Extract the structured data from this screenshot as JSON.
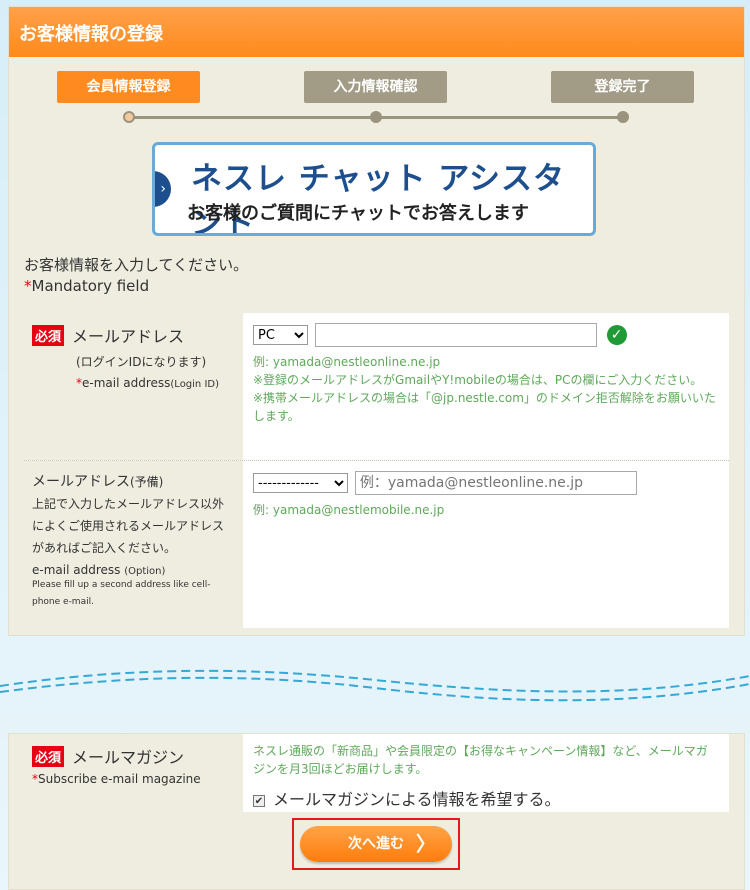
{
  "header": {
    "title": "お客様情報の登録"
  },
  "steps": [
    {
      "label": "会員情報登録"
    },
    {
      "label": "入力情報確認"
    },
    {
      "label": "登録完了"
    }
  ],
  "banner": {
    "title": "ネスレ チャット アシスタント",
    "subtitle": "お客様のご質問にチャットでお答えします",
    "arrow": "›"
  },
  "intro": "お客様情報を入力してください。",
  "mandatory": {
    "mark": "*",
    "text": "Mandatory field"
  },
  "required_badge": "必須",
  "email": {
    "label": "メールアドレス",
    "sub": "(ログインIDになります)",
    "en_mark": "*",
    "en": "e-mail address",
    "en_small": "(Login ID)",
    "device": "PC",
    "value": "",
    "example": "例: yamada@nestleonline.ne.jp",
    "note1": "※登録のメールアドレスがGmailやY!mobileの場合は、PCの欄にご入力ください。",
    "note2": "※携帯メールアドレスの場合は「@jp.nestle.com」のドメイン拒否解除をお願いいたします。"
  },
  "email2": {
    "label": "メールアドレス",
    "label_small": "(予備)",
    "desc": "上記で入力したメールアドレス以外によくご使用されるメールアドレスがあればご記入ください。",
    "en": "e-mail address",
    "en_small": "(Option)",
    "en_desc": "Please fill up a second address like cell-phone e-mail.",
    "select": "-------------",
    "placeholder": "例：yamada@nestleonline.ne.jp",
    "example": "例: yamada@nestlemobile.ne.jp"
  },
  "magazine": {
    "label": "メールマガジン",
    "en_mark": "*",
    "en": "Subscribe e-mail magazine",
    "desc": "ネスレ通販の「新商品」や会員限定の【お得なキャンペーン情報】など、メールマガジンを月3回ほどお届けします。",
    "checkbox_label": "メールマガジンによる情報を希望する。",
    "checked": true
  },
  "next_button": {
    "label": "次へ進む",
    "arrow": "〉"
  },
  "colors": {
    "accent": "#ff8a20",
    "step_inactive": "#a29b86",
    "required": "#e60012",
    "hint": "#5fa85b"
  }
}
